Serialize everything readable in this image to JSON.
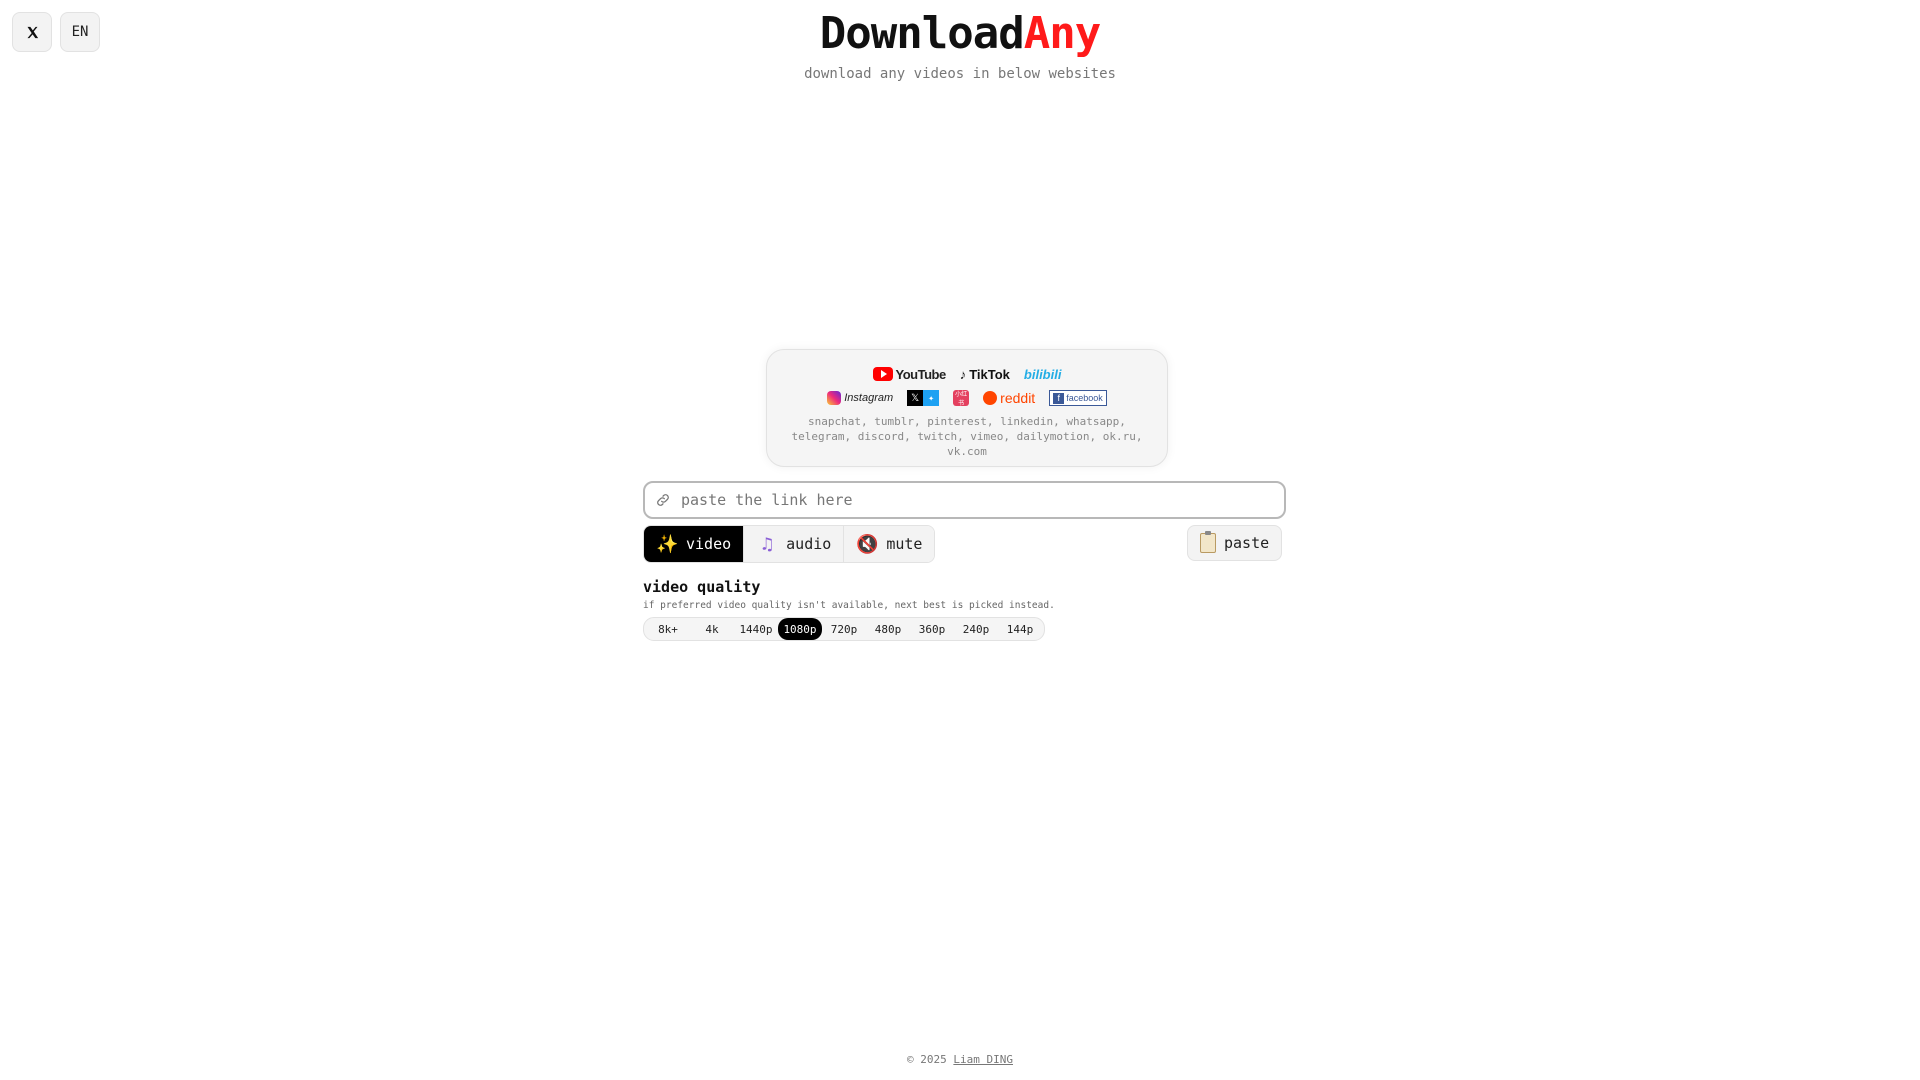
{
  "topbar": {
    "x_icon": "x-logo-icon",
    "language": "EN"
  },
  "header": {
    "title_part1": "Download",
    "title_part2": "Any",
    "subtitle": "download any videos in below websites"
  },
  "sites": {
    "logos_row1": [
      "YouTube",
      "TikTok",
      "bilibili"
    ],
    "logos_row2": [
      "Instagram",
      "X / Twitter",
      "XHS",
      "reddit",
      "facebook"
    ],
    "youtube": "YouTube",
    "tiktok": "TikTok",
    "bilibili": "bilibili",
    "instagram": "Instagram",
    "reddit": "reddit",
    "facebook": "facebook",
    "xhs": "小红书",
    "others": "snapchat, tumblr, pinterest, linkedin, whatsapp, telegram, discord, twitch, vimeo, dailymotion, ok.ru, vk.com"
  },
  "input": {
    "placeholder": "paste the link here",
    "icon": "link-icon"
  },
  "modes": [
    {
      "label": "video",
      "icon": "sparkles-icon",
      "active": true
    },
    {
      "label": "audio",
      "icon": "music-note-icon",
      "active": false
    },
    {
      "label": "mute",
      "icon": "muted-speaker-icon",
      "active": false
    }
  ],
  "paste": {
    "label": "paste",
    "icon": "clipboard-icon"
  },
  "quality": {
    "title": "video quality",
    "subtitle": "if preferred video quality isn't available, next best is picked instead.",
    "options": [
      "8k+",
      "4k",
      "1440p",
      "1080p",
      "720p",
      "480p",
      "360p",
      "240p",
      "144p"
    ],
    "selected": "1080p"
  },
  "footer": {
    "copyright": "© 2025",
    "author": "Liam DING"
  },
  "colors": {
    "accent": "#ff1a1a",
    "active_bg": "#000000"
  }
}
